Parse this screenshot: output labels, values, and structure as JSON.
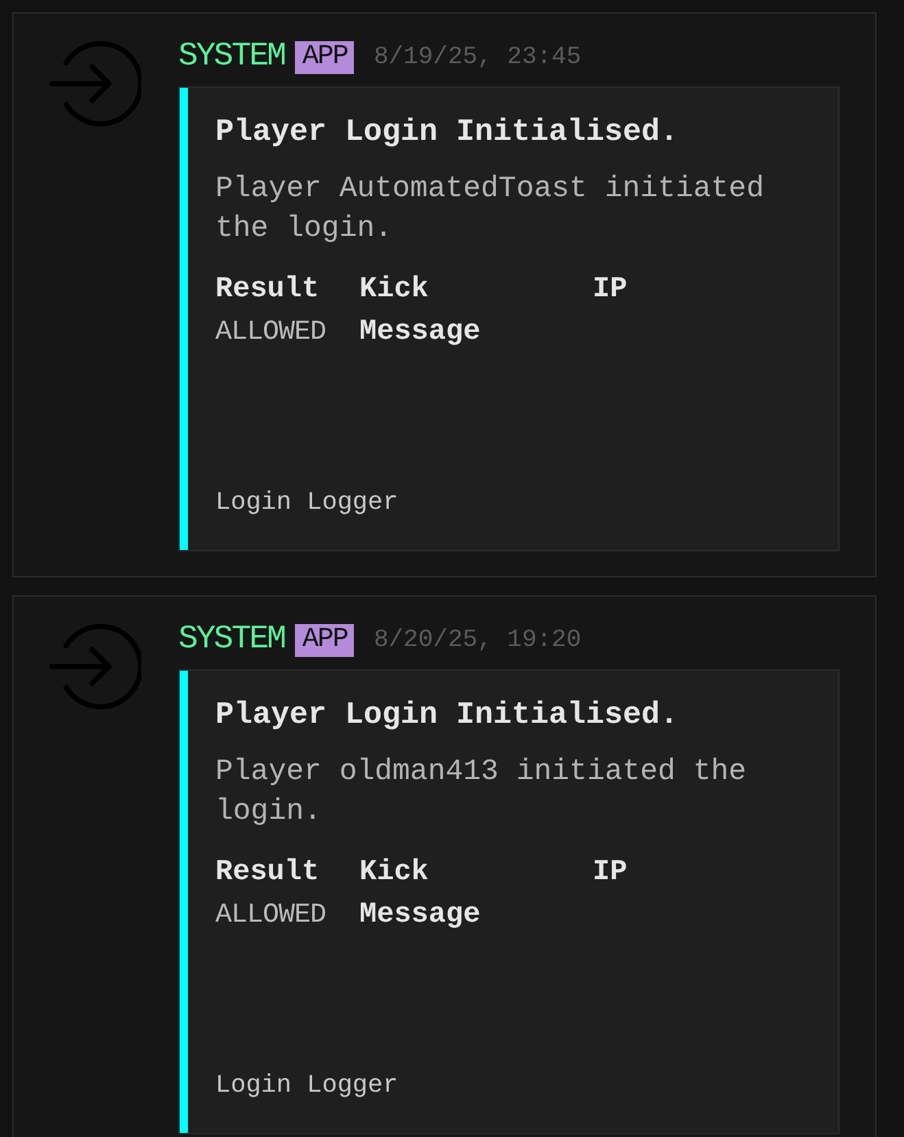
{
  "messages": [
    {
      "author": "SYSTEM",
      "badge": "APP",
      "timestamp": "8/19/25, 23:45",
      "embed": {
        "title": "Player Login Initialised.",
        "description": "Player AutomatedToast initiated the login.",
        "fields": [
          {
            "name": "Result",
            "value": "ALLOWED"
          },
          {
            "name": "Kick Message"
          },
          {
            "name": "IP"
          }
        ],
        "footer": "Login Logger"
      }
    },
    {
      "author": "SYSTEM",
      "badge": "APP",
      "timestamp": "8/20/25, 19:20",
      "embed": {
        "title": "Player Login Initialised.",
        "description": "Player oldman413 initiated the login.",
        "fields": [
          {
            "name": "Result",
            "value": "ALLOWED"
          },
          {
            "name": "Kick Message"
          },
          {
            "name": "IP"
          }
        ],
        "footer": "Login Logger"
      }
    }
  ]
}
